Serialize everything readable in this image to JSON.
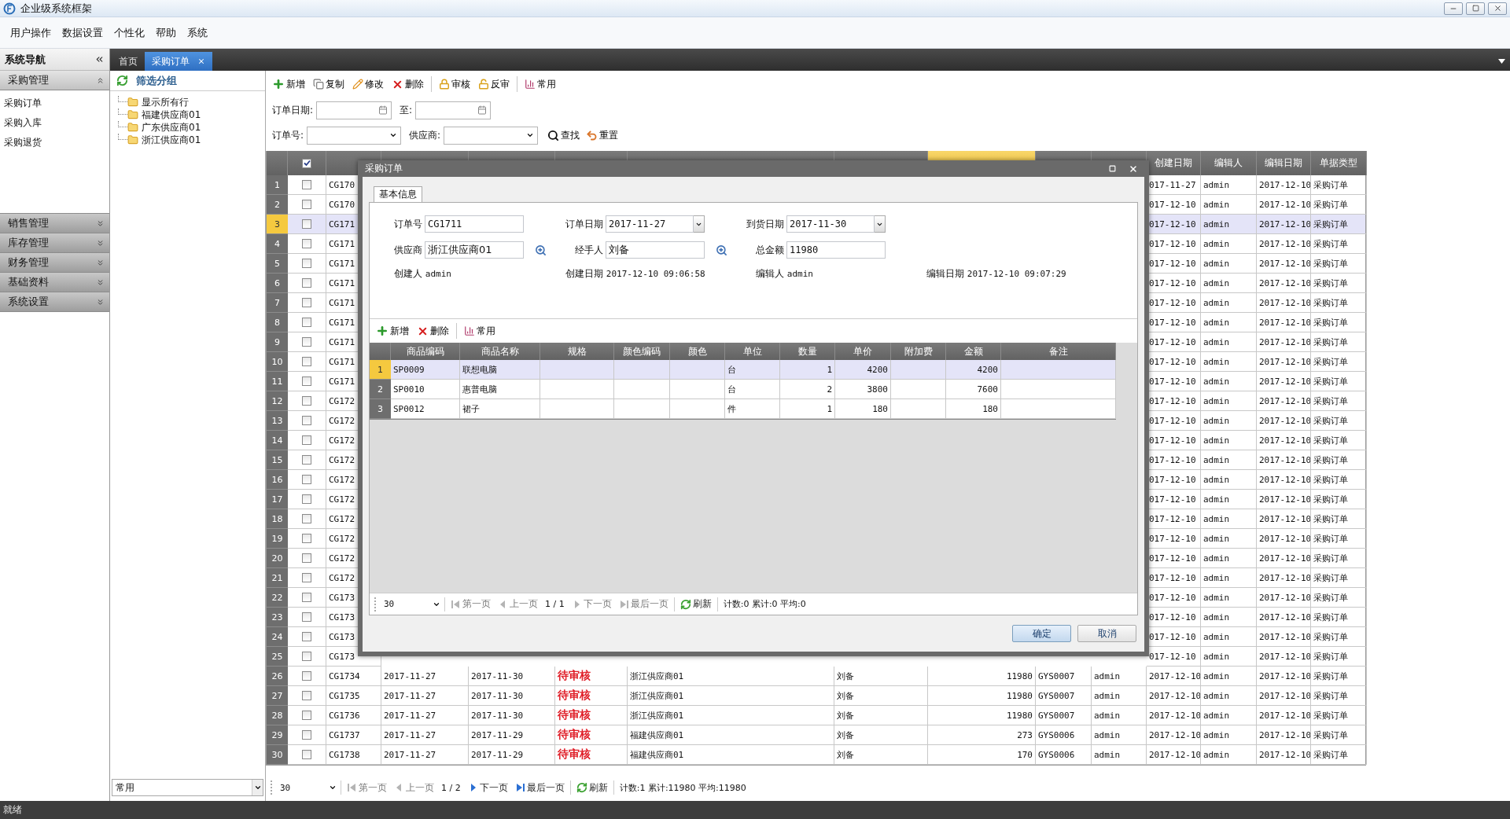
{
  "window": {
    "title": "企业级系统框架"
  },
  "menu": [
    "用户操作",
    "数据设置",
    "个性化",
    "帮助",
    "系统"
  ],
  "sidebar": {
    "title": "系统导航",
    "sections": [
      {
        "label": "采购管理",
        "expanded": true,
        "items": [
          "采购订单",
          "采购入库",
          "采购退货"
        ]
      },
      {
        "label": "销售管理",
        "expanded": false
      },
      {
        "label": "库存管理",
        "expanded": false
      },
      {
        "label": "财务管理",
        "expanded": false
      },
      {
        "label": "基础资料",
        "expanded": false
      },
      {
        "label": "系统设置",
        "expanded": false
      }
    ]
  },
  "tabs": [
    {
      "label": "首页",
      "selected": false,
      "closable": false
    },
    {
      "label": "采购订单",
      "selected": true,
      "closable": true
    }
  ],
  "filter_panel": {
    "title": "筛选分组",
    "tree": [
      "显示所有行",
      "福建供应商01",
      "广东供应商01",
      "浙江供应商01"
    ],
    "preset": "常用"
  },
  "toolbar": [
    {
      "kind": "add",
      "label": "新增"
    },
    {
      "kind": "copy",
      "label": "复制"
    },
    {
      "kind": "edit",
      "label": "修改"
    },
    {
      "kind": "delete",
      "label": "删除"
    },
    {
      "kind": "separator"
    },
    {
      "kind": "approve",
      "label": "审核"
    },
    {
      "kind": "unapprove",
      "label": "反审"
    },
    {
      "kind": "separator"
    },
    {
      "kind": "common",
      "label": "常用"
    }
  ],
  "filters": {
    "order_date": "订单日期:",
    "to": "至:",
    "order_no": "订单号:",
    "supplier": "供应商:",
    "find": "查找",
    "reset": "重置"
  },
  "grid": {
    "header_checked": true,
    "columns": [
      {
        "kind": "text",
        "highlighted": false
      },
      {
        "kind": "text",
        "highlighted": false
      },
      {
        "kind": "text",
        "highlighted": false
      },
      {
        "kind": "status",
        "highlighted": false
      },
      {
        "kind": "text",
        "highlighted": false
      },
      {
        "kind": "text",
        "highlighted": false
      },
      {
        "kind": "number",
        "highlighted": true
      },
      {
        "kind": "text",
        "highlighted": false
      },
      {
        "kind": "text",
        "highlighted": false
      },
      {
        "kind": "text",
        "highlighted": false,
        "label": "创建日期"
      },
      {
        "kind": "text",
        "highlighted": false,
        "label": "编辑人"
      },
      {
        "kind": "text",
        "highlighted": false,
        "label": "编辑日期"
      },
      {
        "kind": "text",
        "highlighted": false,
        "label": "单据类型"
      }
    ],
    "rows": [
      {
        "number": "1",
        "selected": false,
        "checked": false,
        "order_no": "CG170",
        "created_date": "017-11-27",
        "editor": "admin",
        "edit_date": "2017-12-10",
        "type": "采购订单"
      },
      {
        "number": "2",
        "selected": false,
        "checked": false,
        "order_no": "CG170",
        "created_date": "017-12-10",
        "editor": "admin",
        "edit_date": "2017-12-10",
        "type": "采购订单"
      },
      {
        "number": "3",
        "selected": true,
        "checked": false,
        "order_no": "CG171",
        "created_date": "017-12-10",
        "editor": "admin",
        "edit_date": "2017-12-10",
        "type": "采购订单"
      },
      {
        "number": "4",
        "selected": false,
        "checked": false,
        "order_no": "CG171",
        "created_date": "017-12-10",
        "editor": "admin",
        "edit_date": "2017-12-10",
        "type": "采购订单"
      },
      {
        "number": "5",
        "selected": false,
        "checked": false,
        "order_no": "CG171",
        "created_date": "017-12-10",
        "editor": "admin",
        "edit_date": "2017-12-10",
        "type": "采购订单"
      },
      {
        "number": "6",
        "selected": false,
        "checked": false,
        "order_no": "CG171",
        "created_date": "017-12-10",
        "editor": "admin",
        "edit_date": "2017-12-10",
        "type": "采购订单"
      },
      {
        "number": "7",
        "selected": false,
        "checked": false,
        "order_no": "CG171",
        "created_date": "017-12-10",
        "editor": "admin",
        "edit_date": "2017-12-10",
        "type": "采购订单"
      },
      {
        "number": "8",
        "selected": false,
        "checked": false,
        "order_no": "CG171",
        "created_date": "017-12-10",
        "editor": "admin",
        "edit_date": "2017-12-10",
        "type": "采购订单"
      },
      {
        "number": "9",
        "selected": false,
        "checked": false,
        "order_no": "CG171",
        "created_date": "017-12-10",
        "editor": "admin",
        "edit_date": "2017-12-10",
        "type": "采购订单"
      },
      {
        "number": "10",
        "selected": false,
        "checked": false,
        "order_no": "CG171",
        "created_date": "017-12-10",
        "editor": "admin",
        "edit_date": "2017-12-10",
        "type": "采购订单"
      },
      {
        "number": "11",
        "selected": false,
        "checked": false,
        "order_no": "CG171",
        "created_date": "017-12-10",
        "editor": "admin",
        "edit_date": "2017-12-10",
        "type": "采购订单"
      },
      {
        "number": "12",
        "selected": false,
        "checked": false,
        "order_no": "CG172",
        "created_date": "017-12-10",
        "editor": "admin",
        "edit_date": "2017-12-10",
        "type": "采购订单"
      },
      {
        "number": "13",
        "selected": false,
        "checked": false,
        "order_no": "CG172",
        "created_date": "017-12-10",
        "editor": "admin",
        "edit_date": "2017-12-10",
        "type": "采购订单"
      },
      {
        "number": "14",
        "selected": false,
        "checked": false,
        "order_no": "CG172",
        "created_date": "017-12-10",
        "editor": "admin",
        "edit_date": "2017-12-10",
        "type": "采购订单"
      },
      {
        "number": "15",
        "selected": false,
        "checked": false,
        "order_no": "CG172",
        "created_date": "017-12-10",
        "editor": "admin",
        "edit_date": "2017-12-10",
        "type": "采购订单"
      },
      {
        "number": "16",
        "selected": false,
        "checked": false,
        "order_no": "CG172",
        "created_date": "017-12-10",
        "editor": "admin",
        "edit_date": "2017-12-10",
        "type": "采购订单"
      },
      {
        "number": "17",
        "selected": false,
        "checked": false,
        "order_no": "CG172",
        "created_date": "017-12-10",
        "editor": "admin",
        "edit_date": "2017-12-10",
        "type": "采购订单"
      },
      {
        "number": "18",
        "selected": false,
        "checked": false,
        "order_no": "CG172",
        "created_date": "017-12-10",
        "editor": "admin",
        "edit_date": "2017-12-10",
        "type": "采购订单"
      },
      {
        "number": "19",
        "selected": false,
        "checked": false,
        "order_no": "CG172",
        "created_date": "017-12-10",
        "editor": "admin",
        "edit_date": "2017-12-10",
        "type": "采购订单"
      },
      {
        "number": "20",
        "selected": false,
        "checked": false,
        "order_no": "CG172",
        "created_date": "017-12-10",
        "editor": "admin",
        "edit_date": "2017-12-10",
        "type": "采购订单"
      },
      {
        "number": "21",
        "selected": false,
        "checked": false,
        "order_no": "CG172",
        "created_date": "017-12-10",
        "editor": "admin",
        "edit_date": "2017-12-10",
        "type": "采购订单"
      },
      {
        "number": "22",
        "selected": false,
        "checked": false,
        "order_no": "CG173",
        "created_date": "017-12-10",
        "editor": "admin",
        "edit_date": "2017-12-10",
        "type": "采购订单"
      },
      {
        "number": "23",
        "selected": false,
        "checked": false,
        "order_no": "CG173",
        "created_date": "017-12-10",
        "editor": "admin",
        "edit_date": "2017-12-10",
        "type": "采购订单"
      },
      {
        "number": "24",
        "selected": false,
        "checked": false,
        "order_no": "CG173",
        "created_date": "017-12-10",
        "editor": "admin",
        "edit_date": "2017-12-10",
        "type": "采购订单"
      },
      {
        "number": "25",
        "selected": false,
        "checked": false,
        "order_no": "CG173",
        "created_date": "017-12-10",
        "editor": "admin",
        "edit_date": "2017-12-10",
        "type": "采购订单"
      },
      {
        "number": "26",
        "selected": false,
        "checked": false,
        "order_no": "CG1734",
        "order_date": "2017-11-27",
        "arrival_date": "2017-11-30",
        "status": "待审核",
        "supplier": "浙江供应商01",
        "handler": "刘备",
        "amount": "11980",
        "supplier_code": "GYS0007",
        "creator": "admin",
        "created_date": "2017-12-10",
        "editor": "admin",
        "edit_date": "2017-12-10",
        "type": "采购订单"
      },
      {
        "number": "27",
        "selected": false,
        "checked": false,
        "order_no": "CG1735",
        "order_date": "2017-11-27",
        "arrival_date": "2017-11-30",
        "status": "待审核",
        "supplier": "浙江供应商01",
        "handler": "刘备",
        "amount": "11980",
        "supplier_code": "GYS0007",
        "creator": "admin",
        "created_date": "2017-12-10",
        "editor": "admin",
        "edit_date": "2017-12-10",
        "type": "采购订单"
      },
      {
        "number": "28",
        "selected": false,
        "checked": false,
        "order_no": "CG1736",
        "order_date": "2017-11-27",
        "arrival_date": "2017-11-30",
        "status": "待审核",
        "supplier": "浙江供应商01",
        "handler": "刘备",
        "amount": "11980",
        "supplier_code": "GYS0007",
        "creator": "admin",
        "created_date": "2017-12-10",
        "editor": "admin",
        "edit_date": "2017-12-10",
        "type": "采购订单"
      },
      {
        "number": "29",
        "selected": false,
        "checked": false,
        "order_no": "CG1737",
        "order_date": "2017-11-27",
        "arrival_date": "2017-11-29",
        "status": "待审核",
        "supplier": "福建供应商01",
        "handler": "刘备",
        "amount": "273",
        "supplier_code": "GYS0006",
        "creator": "admin",
        "created_date": "2017-12-10",
        "editor": "admin",
        "edit_date": "2017-12-10",
        "type": "采购订单"
      },
      {
        "number": "30",
        "selected": false,
        "checked": false,
        "order_no": "CG1738",
        "order_date": "2017-11-27",
        "arrival_date": "2017-11-29",
        "status": "待审核",
        "supplier": "福建供应商01",
        "handler": "刘备",
        "amount": "170",
        "supplier_code": "GYS0006",
        "creator": "admin",
        "created_date": "2017-12-10",
        "editor": "admin",
        "edit_date": "2017-12-10",
        "type": "采购订单"
      }
    ]
  },
  "pager": {
    "page_size": "30",
    "items": [
      {
        "kind": "first",
        "label": "第一页",
        "disabled": true
      },
      {
        "kind": "prev",
        "label": "上一页",
        "disabled": true
      },
      {
        "kind": "page",
        "label": "1 / 2"
      },
      {
        "kind": "next",
        "label": "下一页",
        "disabled": false
      },
      {
        "kind": "last",
        "label": "最后一页",
        "disabled": false
      },
      {
        "kind": "refresh",
        "label": "刷新"
      },
      {
        "kind": "stats",
        "label": "计数:1 累计:11980 平均:11980"
      }
    ]
  },
  "dialog": {
    "title": "采购订单",
    "tab": "基本信息",
    "fields": [
      {
        "label": "订单号",
        "value": "CG1711",
        "kind": "text"
      },
      {
        "label": "订单日期",
        "value": "2017-11-27",
        "kind": "combo"
      },
      {
        "label": "到货日期",
        "value": "2017-11-30",
        "kind": "combo"
      },
      {
        "label": "供应商",
        "value": "浙江供应商01",
        "kind": "lookup"
      },
      {
        "label": "经手人",
        "value": "刘备",
        "kind": "lookup"
      },
      {
        "label": "总金额",
        "value": "11980",
        "kind": "text"
      }
    ],
    "info": [
      {
        "label": "创建人",
        "value": "admin"
      },
      {
        "label": "创建日期",
        "value": "2017-12-10 09:06:58"
      },
      {
        "label": "编辑人",
        "value": "admin"
      },
      {
        "label": "编辑日期",
        "value": "2017-12-10 09:07:29"
      }
    ],
    "toolbar": [
      {
        "kind": "add",
        "label": "新增"
      },
      {
        "kind": "delete",
        "label": "删除"
      },
      {
        "kind": "separator"
      },
      {
        "kind": "common",
        "label": "常用"
      }
    ],
    "columns": [
      {
        "label": "商品编码",
        "kind": "text"
      },
      {
        "label": "商品名称",
        "kind": "text"
      },
      {
        "label": "规格",
        "kind": "text"
      },
      {
        "label": "颜色编码",
        "kind": "text"
      },
      {
        "label": "颜色",
        "kind": "text"
      },
      {
        "label": "单位",
        "kind": "text"
      },
      {
        "label": "数量",
        "kind": "number"
      },
      {
        "label": "单价",
        "kind": "number"
      },
      {
        "label": "附加费",
        "kind": "number"
      },
      {
        "label": "金额",
        "kind": "number"
      },
      {
        "label": "备注",
        "kind": "text"
      }
    ],
    "rows": [
      {
        "number": "1",
        "selected": true,
        "code": "SP0009",
        "name": "联想电脑",
        "unit": "台",
        "qty": "1",
        "price": "4200",
        "amount": "4200"
      },
      {
        "number": "2",
        "selected": false,
        "code": "SP0010",
        "name": "惠普电脑",
        "unit": "台",
        "qty": "2",
        "price": "3800",
        "amount": "7600"
      },
      {
        "number": "3",
        "selected": false,
        "code": "SP0012",
        "name": "裙子",
        "unit": "件",
        "qty": "1",
        "price": "180",
        "amount": "180"
      }
    ],
    "pager": {
      "page_size": "30",
      "items": [
        {
          "kind": "first",
          "label": "第一页",
          "disabled": true
        },
        {
          "kind": "prev",
          "label": "上一页",
          "disabled": true
        },
        {
          "kind": "page",
          "label": "1 / 1"
        },
        {
          "kind": "next",
          "label": "下一页",
          "disabled": true
        },
        {
          "kind": "last",
          "label": "最后一页",
          "disabled": true
        },
        {
          "kind": "refresh",
          "label": "刷新"
        },
        {
          "kind": "stats",
          "label": "计数:0 累计:0 平均:0"
        }
      ]
    },
    "buttons": [
      {
        "label": "确定",
        "primary": true
      },
      {
        "label": "取消",
        "primary": false
      }
    ]
  },
  "status_bar": "就绪"
}
